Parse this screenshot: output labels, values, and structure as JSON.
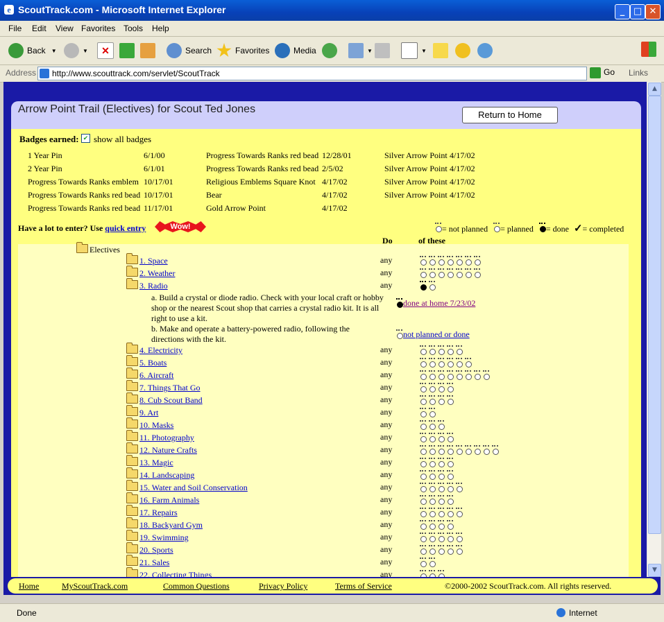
{
  "window": {
    "title": "ScoutTrack.com - Microsoft Internet Explorer"
  },
  "menu": [
    "File",
    "Edit",
    "View",
    "Favorites",
    "Tools",
    "Help"
  ],
  "toolbar": {
    "back": "Back",
    "search": "Search",
    "favorites": "Favorites",
    "media": "Media"
  },
  "address": {
    "label": "Address",
    "url": "http://www.scouttrack.com/servlet/ScoutTrack",
    "go": "Go",
    "links": "Links"
  },
  "page": {
    "heading": "Arrow Point Trail (Electives) for Scout Ted Jones",
    "return_button": "Return to Home",
    "badges_label": "Badges earned:",
    "show_all": "show all badges",
    "badges": [
      [
        "1 Year Pin",
        "6/1/00",
        "Progress Towards Ranks red bead",
        "12/28/01",
        "Silver Arrow Point",
        "4/17/02"
      ],
      [
        "2 Year Pin",
        "6/1/01",
        "Progress Towards Ranks red bead",
        "2/5/02",
        "Silver Arrow Point",
        "4/17/02"
      ],
      [
        "Progress Towards Ranks emblem",
        "10/17/01",
        "Religious Emblems Square Knot",
        "4/17/02",
        "Silver Arrow Point",
        "4/17/02"
      ],
      [
        "Progress Towards Ranks red bead",
        "10/17/01",
        "Bear",
        "4/17/02",
        "Silver Arrow Point",
        "4/17/02"
      ],
      [
        "Progress Towards Ranks red bead",
        "11/17/01",
        "Gold Arrow Point",
        "4/17/02",
        "",
        ""
      ]
    ],
    "quick_prefix": "Have a lot to enter? Use ",
    "quick_link": "quick entry",
    "wow": "Wow!",
    "legend": {
      "not_planned": "= not planned",
      "planned": "= planned",
      "done": "= done",
      "completed": "= completed"
    },
    "col_do": "Do",
    "col_of": "of these",
    "root": "Electives",
    "electives": [
      {
        "label": "1. Space",
        "do": "any",
        "paws": 7,
        "done": 0
      },
      {
        "label": "2. Weather",
        "do": "any",
        "paws": 7,
        "done": 0
      },
      {
        "label": "3. Radio",
        "do": "any",
        "paws": 2,
        "done": 1
      },
      {
        "label": "4. Electricity",
        "do": "any",
        "paws": 5,
        "done": 0
      },
      {
        "label": "5. Boats",
        "do": "any",
        "paws": 6,
        "done": 0
      },
      {
        "label": "6. Aircraft",
        "do": "any",
        "paws": 8,
        "done": 0
      },
      {
        "label": "7. Things That Go",
        "do": "any",
        "paws": 4,
        "done": 0
      },
      {
        "label": "8. Cub Scout Band",
        "do": "any",
        "paws": 4,
        "done": 0
      },
      {
        "label": "9. Art",
        "do": "any",
        "paws": 2,
        "done": 0
      },
      {
        "label": "10. Masks",
        "do": "any",
        "paws": 3,
        "done": 0
      },
      {
        "label": "11. Photography",
        "do": "any",
        "paws": 4,
        "done": 0
      },
      {
        "label": "12. Nature Crafts",
        "do": "any",
        "paws": 9,
        "done": 0
      },
      {
        "label": "13. Magic",
        "do": "any",
        "paws": 4,
        "done": 0
      },
      {
        "label": "14. Landscaping",
        "do": "any",
        "paws": 4,
        "done": 0
      },
      {
        "label": "15. Water and Soil Conservation",
        "do": "any",
        "paws": 5,
        "done": 0
      },
      {
        "label": "16. Farm Animals",
        "do": "any",
        "paws": 4,
        "done": 0
      },
      {
        "label": "17. Repairs",
        "do": "any",
        "paws": 5,
        "done": 0
      },
      {
        "label": "18. Backyard Gym",
        "do": "any",
        "paws": 4,
        "done": 0
      },
      {
        "label": "19. Swimming",
        "do": "any",
        "paws": 5,
        "done": 0
      },
      {
        "label": "20. Sports",
        "do": "any",
        "paws": 5,
        "done": 0
      },
      {
        "label": "21. Sales",
        "do": "any",
        "paws": 2,
        "done": 0
      },
      {
        "label": "22. Collecting Things",
        "do": "any",
        "paws": 3,
        "done": 0
      }
    ],
    "radio_req_a": "a. Build a crystal or diode radio. Check with your local craft or hobby shop or the nearest Scout shop that carries a crystal radio kit. It is all right to use a kit.",
    "radio_req_a_status": "done at home 7/23/02",
    "radio_req_b": "b. Make and operate a battery-powered radio, following the directions with the kit.",
    "radio_req_b_status": "not planned or done"
  },
  "footer": {
    "home": "Home",
    "my": "MyScoutTrack.com",
    "faq": "Common Questions",
    "privacy": "Privacy Policy",
    "terms": "Terms of Service",
    "copyright": "©2000-2002 ScoutTrack.com. All rights reserved."
  },
  "statusbar": {
    "status": "Done",
    "zone": "Internet"
  }
}
